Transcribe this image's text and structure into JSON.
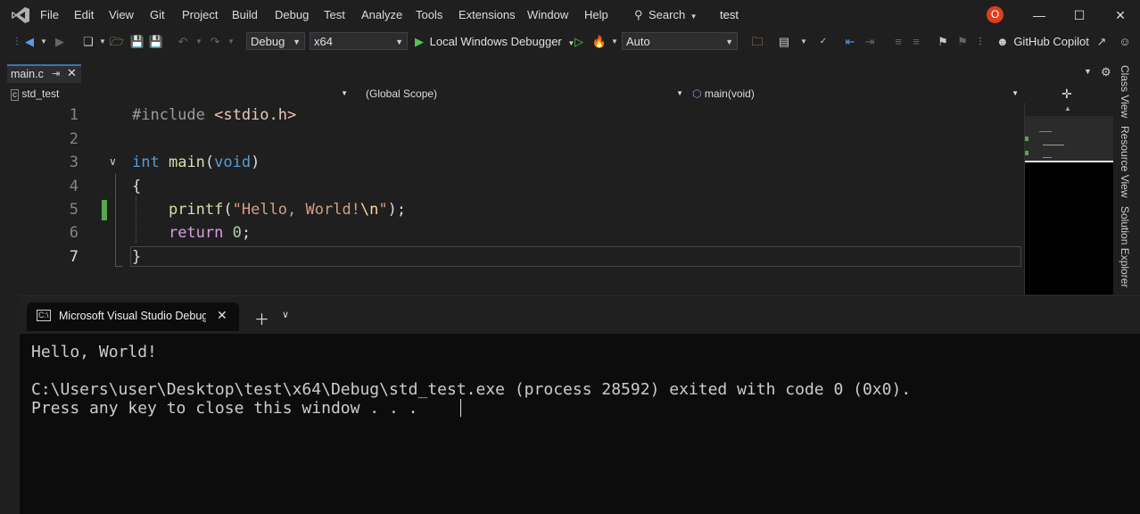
{
  "menu": {
    "items": [
      "File",
      "Edit",
      "View",
      "Git",
      "Project",
      "Build",
      "Debug",
      "Test",
      "Analyze",
      "Tools",
      "Extensions",
      "Window",
      "Help"
    ],
    "search_label": "Search",
    "solution_name": "test",
    "user_initial": "O"
  },
  "toolbar": {
    "configuration": "Debug",
    "platform": "x64",
    "debugger_label": "Local Windows Debugger",
    "auto_label": "Auto",
    "copilot_label": "GitHub Copilot"
  },
  "document_tab": {
    "filename": "main.c"
  },
  "navbar": {
    "project": "std_test",
    "scope": "(Global Scope)",
    "member": "main(void)"
  },
  "editor": {
    "line_numbers": [
      "1",
      "2",
      "3",
      "4",
      "5",
      "6",
      "7"
    ],
    "lines": [
      {
        "tokens": [
          [
            "pp",
            "#include "
          ],
          [
            "inc",
            "<stdio.h>"
          ]
        ]
      },
      {
        "tokens": []
      },
      {
        "tokens": [
          [
            "kw",
            "int"
          ],
          [
            "plain",
            " "
          ],
          [
            "fn",
            "main"
          ],
          [
            "plain",
            "("
          ],
          [
            "kw",
            "void"
          ],
          [
            "plain",
            ")"
          ]
        ]
      },
      {
        "tokens": [
          [
            "plain",
            "{"
          ]
        ]
      },
      {
        "tokens": [
          [
            "plain",
            "    "
          ],
          [
            "fn",
            "printf"
          ],
          [
            "plain",
            "("
          ],
          [
            "str",
            "\"Hello, World!"
          ],
          [
            "esc",
            "\\n"
          ],
          [
            "str",
            "\""
          ],
          [
            "plain",
            ");"
          ]
        ]
      },
      {
        "tokens": [
          [
            "plain",
            "    "
          ],
          [
            "ctl",
            "return"
          ],
          [
            "plain",
            " "
          ],
          [
            "num",
            "0"
          ],
          [
            "plain",
            ";"
          ]
        ]
      },
      {
        "tokens": [
          [
            "plain",
            "}"
          ]
        ]
      }
    ]
  },
  "side_panel": {
    "tabs": [
      "Class View",
      "Resource View",
      "Solution Explorer"
    ]
  },
  "terminal": {
    "tab_title": "Microsoft Visual Studio Debug",
    "output": [
      "Hello, World!",
      "",
      "C:\\Users\\user\\Desktop\\test\\x64\\Debug\\std_test.exe (process 28592) exited with code 0 (0x0).",
      "Press any key to close this window . . ."
    ]
  },
  "colors": {
    "accent": "#3e6fb2",
    "changed_line": "#57a64a",
    "play_green": "#4ec94e"
  }
}
